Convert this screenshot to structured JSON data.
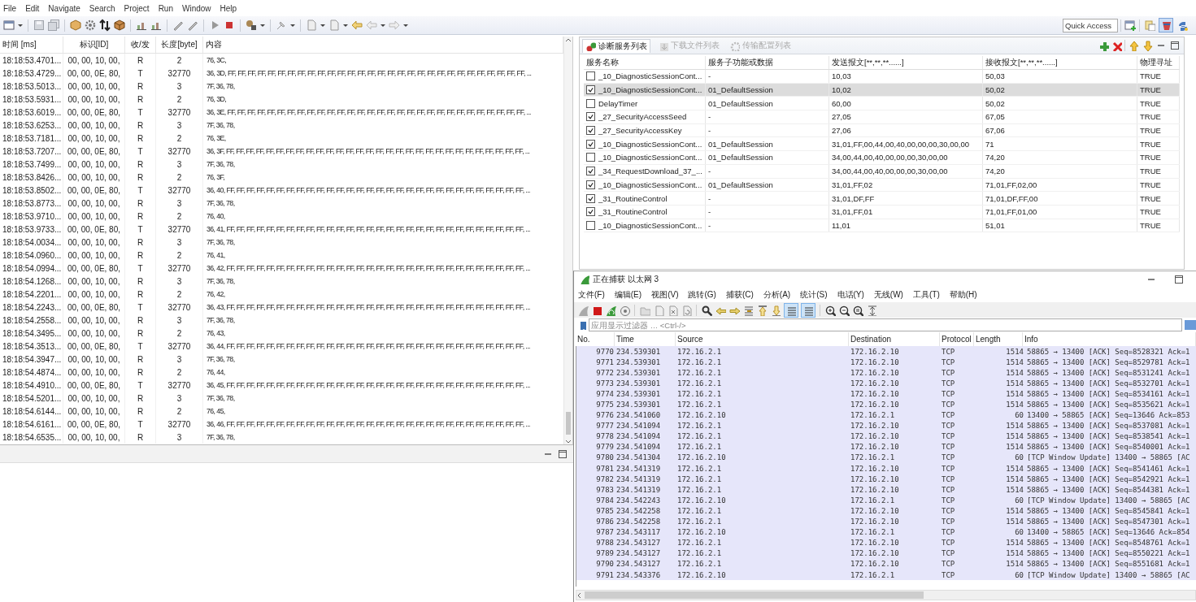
{
  "menu": [
    "File",
    "Edit",
    "Navigate",
    "Search",
    "Project",
    "Run",
    "Window",
    "Help"
  ],
  "quick_access": {
    "placeholder": "Quick Access"
  },
  "perspectives": [
    {
      "selected": false
    },
    {
      "selected": true
    },
    {
      "selected": false
    }
  ],
  "can_table": {
    "columns": [
      "时间 [ms]",
      "标识[ID]",
      "收/发",
      "长度[byte]",
      "内容"
    ],
    "rows": [
      {
        "time": "18:18:53.4701...",
        "id": "00, 00, 10, 00,",
        "dir": "R",
        "length": "2",
        "data": "76, 3C,"
      },
      {
        "time": "18:18:53.4729...",
        "id": "00, 00, 0E, 80,",
        "dir": "T",
        "length": "32770",
        "data": "36, 3D, FF, FF, FF, FF, FF, FF, FF, FF, FF, FF, FF, FF, FF, FF, FF, FF, FF, FF, FF, FF, FF, FF, FF, FF, FF, FF, FF, FF, FF, FF, ..."
      },
      {
        "time": "18:18:53.5013...",
        "id": "00, 00, 10, 00,",
        "dir": "R",
        "length": "3",
        "data": "7F, 36, 78,"
      },
      {
        "time": "18:18:53.5931...",
        "id": "00, 00, 10, 00,",
        "dir": "R",
        "length": "2",
        "data": "76, 3D,"
      },
      {
        "time": "18:18:53.6019...",
        "id": "00, 00, 0E, 80,",
        "dir": "T",
        "length": "32770",
        "data": "36, 3E, FF, FF, FF, FF, FF, FF, FF, FF, FF, FF, FF, FF, FF, FF, FF, FF, FF, FF, FF, FF, FF, FF, FF, FF, FF, FF, FF, FF, FF, FF, ..."
      },
      {
        "time": "18:18:53.6253...",
        "id": "00, 00, 10, 00,",
        "dir": "R",
        "length": "3",
        "data": "7F, 36, 78,"
      },
      {
        "time": "18:18:53.7181...",
        "id": "00, 00, 10, 00,",
        "dir": "R",
        "length": "2",
        "data": "76, 3E,"
      },
      {
        "time": "18:18:53.7207...",
        "id": "00, 00, 0E, 80,",
        "dir": "T",
        "length": "32770",
        "data": "36, 3F, FF, FF, FF, FF, FF, FF, FF, FF, FF, FF, FF, FF, FF, FF, FF, FF, FF, FF, FF, FF, FF, FF, FF, FF, FF, FF, FF, FF, FF, FF, ..."
      },
      {
        "time": "18:18:53.7499...",
        "id": "00, 00, 10, 00,",
        "dir": "R",
        "length": "3",
        "data": "7F, 36, 78,"
      },
      {
        "time": "18:18:53.8426...",
        "id": "00, 00, 10, 00,",
        "dir": "R",
        "length": "2",
        "data": "76, 3F,"
      },
      {
        "time": "18:18:53.8502...",
        "id": "00, 00, 0E, 80,",
        "dir": "T",
        "length": "32770",
        "data": "36, 40, FF, FF, FF, FF, FF, FF, FF, FF, FF, FF, FF, FF, FF, FF, FF, FF, FF, FF, FF, FF, FF, FF, FF, FF, FF, FF, FF, FF, FF, FF, ..."
      },
      {
        "time": "18:18:53.8773...",
        "id": "00, 00, 10, 00,",
        "dir": "R",
        "length": "3",
        "data": "7F, 36, 78,"
      },
      {
        "time": "18:18:53.9710...",
        "id": "00, 00, 10, 00,",
        "dir": "R",
        "length": "2",
        "data": "76, 40,"
      },
      {
        "time": "18:18:53.9733...",
        "id": "00, 00, 0E, 80,",
        "dir": "T",
        "length": "32770",
        "data": "36, 41, FF, FF, FF, FF, FF, FF, FF, FF, FF, FF, FF, FF, FF, FF, FF, FF, FF, FF, FF, FF, FF, FF, FF, FF, FF, FF, FF, FF, FF, FF, ..."
      },
      {
        "time": "18:18:54.0034...",
        "id": "00, 00, 10, 00,",
        "dir": "R",
        "length": "3",
        "data": "7F, 36, 78,"
      },
      {
        "time": "18:18:54.0960...",
        "id": "00, 00, 10, 00,",
        "dir": "R",
        "length": "2",
        "data": "76, 41,"
      },
      {
        "time": "18:18:54.0994...",
        "id": "00, 00, 0E, 80,",
        "dir": "T",
        "length": "32770",
        "data": "36, 42, FF, FF, FF, FF, FF, FF, FF, FF, FF, FF, FF, FF, FF, FF, FF, FF, FF, FF, FF, FF, FF, FF, FF, FF, FF, FF, FF, FF, FF, FF, ..."
      },
      {
        "time": "18:18:54.1268...",
        "id": "00, 00, 10, 00,",
        "dir": "R",
        "length": "3",
        "data": "7F, 36, 78,"
      },
      {
        "time": "18:18:54.2201...",
        "id": "00, 00, 10, 00,",
        "dir": "R",
        "length": "2",
        "data": "76, 42,"
      },
      {
        "time": "18:18:54.2243...",
        "id": "00, 00, 0E, 80,",
        "dir": "T",
        "length": "32770",
        "data": "36, 43, FF, FF, FF, FF, FF, FF, FF, FF, FF, FF, FF, FF, FF, FF, FF, FF, FF, FF, FF, FF, FF, FF, FF, FF, FF, FF, FF, FF, FF, FF, ..."
      },
      {
        "time": "18:18:54.2558...",
        "id": "00, 00, 10, 00,",
        "dir": "R",
        "length": "3",
        "data": "7F, 36, 78,"
      },
      {
        "time": "18:18:54.3495...",
        "id": "00, 00, 10, 00,",
        "dir": "R",
        "length": "2",
        "data": "76, 43,"
      },
      {
        "time": "18:18:54.3513...",
        "id": "00, 00, 0E, 80,",
        "dir": "T",
        "length": "32770",
        "data": "36, 44, FF, FF, FF, FF, FF, FF, FF, FF, FF, FF, FF, FF, FF, FF, FF, FF, FF, FF, FF, FF, FF, FF, FF, FF, FF, FF, FF, FF, FF, FF, ..."
      },
      {
        "time": "18:18:54.3947...",
        "id": "00, 00, 10, 00,",
        "dir": "R",
        "length": "3",
        "data": "7F, 36, 78,"
      },
      {
        "time": "18:18:54.4874...",
        "id": "00, 00, 10, 00,",
        "dir": "R",
        "length": "2",
        "data": "76, 44,"
      },
      {
        "time": "18:18:54.4910...",
        "id": "00, 00, 0E, 80,",
        "dir": "T",
        "length": "32770",
        "data": "36, 45, FF, FF, FF, FF, FF, FF, FF, FF, FF, FF, FF, FF, FF, FF, FF, FF, FF, FF, FF, FF, FF, FF, FF, FF, FF, FF, FF, FF, FF, FF, ..."
      },
      {
        "time": "18:18:54.5201...",
        "id": "00, 00, 10, 00,",
        "dir": "R",
        "length": "3",
        "data": "7F, 36, 78,"
      },
      {
        "time": "18:18:54.6144...",
        "id": "00, 00, 10, 00,",
        "dir": "R",
        "length": "2",
        "data": "76, 45,"
      },
      {
        "time": "18:18:54.6161...",
        "id": "00, 00, 0E, 80,",
        "dir": "T",
        "length": "32770",
        "data": "36, 46, FF, FF, FF, FF, FF, FF, FF, FF, FF, FF, FF, FF, FF, FF, FF, FF, FF, FF, FF, FF, FF, FF, FF, FF, FF, FF, FF, FF, FF, FF, ..."
      },
      {
        "time": "18:18:54.6535...",
        "id": "00, 00, 10, 00,",
        "dir": "R",
        "length": "3",
        "data": "7F, 36, 78,"
      }
    ]
  },
  "diag_panel": {
    "tabs": [
      {
        "label": "诊断服务列表",
        "selected": true,
        "disabled": false
      },
      {
        "label": "下载文件列表",
        "selected": false,
        "disabled": true
      },
      {
        "label": "传输配置列表",
        "selected": false,
        "disabled": true
      }
    ]
  },
  "diag_table": {
    "columns": [
      "服务名称",
      "服务子功能或数据",
      "发送报文[**,**,**......]",
      "接收报文[**,**,**......]",
      "物理寻址"
    ],
    "rows": [
      {
        "checked": false,
        "selected": false,
        "name": "_10_DiagnosticSessionCont...",
        "sub_function": "-",
        "send": "10,03",
        "receive": "50,03",
        "physical": "TRUE"
      },
      {
        "checked": true,
        "selected": true,
        "name": "_10_DiagnosticSessionCont...",
        "sub_function": "01_DefaultSession",
        "send": "10,02",
        "receive": "50,02",
        "physical": "TRUE"
      },
      {
        "checked": false,
        "selected": false,
        "name": "DelayTimer",
        "sub_function": "01_DefaultSession",
        "send": "60,00",
        "receive": "50,02",
        "physical": "TRUE"
      },
      {
        "checked": true,
        "selected": false,
        "name": "_27_SecurityAccessSeed",
        "sub_function": "-",
        "send": "27,05",
        "receive": "67,05",
        "physical": "TRUE"
      },
      {
        "checked": true,
        "selected": false,
        "name": "_27_SecurityAccessKey",
        "sub_function": "-",
        "send": "27,06",
        "receive": "67,06",
        "physical": "TRUE"
      },
      {
        "checked": true,
        "selected": false,
        "name": "_10_DiagnosticSessionCont...",
        "sub_function": "01_DefaultSession",
        "send": "31,01,FF,00,44,00,40,00,00,00,30,00,00",
        "receive": "71",
        "physical": "TRUE"
      },
      {
        "checked": false,
        "selected": false,
        "name": "_10_DiagnosticSessionCont...",
        "sub_function": "01_DefaultSession",
        "send": "34,00,44,00,40,00,00,00,30,00,00",
        "receive": "74,20",
        "physical": "TRUE"
      },
      {
        "checked": true,
        "selected": false,
        "name": "_34_RequestDownload_37_...",
        "sub_function": "-",
        "send": "34,00,44,00,40,00,00,00,30,00,00",
        "receive": "74,20",
        "physical": "TRUE"
      },
      {
        "checked": true,
        "selected": false,
        "name": "_10_DiagnosticSessionCont...",
        "sub_function": "01_DefaultSession",
        "send": "31,01,FF,02",
        "receive": "71,01,FF,02,00",
        "physical": "TRUE"
      },
      {
        "checked": true,
        "selected": false,
        "name": "_31_RoutineControl",
        "sub_function": "-",
        "send": "31,01,DF,FF",
        "receive": "71,01,DF,FF,00",
        "physical": "TRUE"
      },
      {
        "checked": true,
        "selected": false,
        "name": "_31_RoutineControl",
        "sub_function": "-",
        "send": "31,01,FF,01",
        "receive": "71,01,FF,01,00",
        "physical": "TRUE"
      },
      {
        "checked": false,
        "selected": false,
        "name": "_10_DiagnosticSessionCont...",
        "sub_function": "-",
        "send": "11,01",
        "receive": "51,01",
        "physical": "TRUE"
      }
    ]
  },
  "wireshark": {
    "title": "正在捕获 以太网 3",
    "menu": [
      "文件(F)",
      "编辑(E)",
      "视图(V)",
      "跳转(G)",
      "捕获(C)",
      "分析(A)",
      "统计(S)",
      "电话(Y)",
      "无线(W)",
      "工具(T)",
      "帮助(H)"
    ],
    "view_toggles": [
      {
        "on": true
      },
      {
        "on": true
      }
    ],
    "filter": {
      "placeholder": "应用显示过滤器 … <Ctrl-/>"
    },
    "columns": [
      "No.",
      "Time",
      "Source",
      "Destination",
      "Protocol",
      "Length",
      "Info"
    ],
    "rows": [
      {
        "no": "9770",
        "time": "234.539301",
        "source": "172.16.2.1",
        "destination": "172.16.2.10",
        "protocol": "TCP",
        "length": "1514",
        "info": "58865 → 13400 [ACK] Seq=8528321 Ack=1"
      },
      {
        "no": "9771",
        "time": "234.539301",
        "source": "172.16.2.1",
        "destination": "172.16.2.10",
        "protocol": "TCP",
        "length": "1514",
        "info": "58865 → 13400 [ACK] Seq=8529781 Ack=1"
      },
      {
        "no": "9772",
        "time": "234.539301",
        "source": "172.16.2.1",
        "destination": "172.16.2.10",
        "protocol": "TCP",
        "length": "1514",
        "info": "58865 → 13400 [ACK] Seq=8531241 Ack=1"
      },
      {
        "no": "9773",
        "time": "234.539301",
        "source": "172.16.2.1",
        "destination": "172.16.2.10",
        "protocol": "TCP",
        "length": "1514",
        "info": "58865 → 13400 [ACK] Seq=8532701 Ack=1"
      },
      {
        "no": "9774",
        "time": "234.539301",
        "source": "172.16.2.1",
        "destination": "172.16.2.10",
        "protocol": "TCP",
        "length": "1514",
        "info": "58865 → 13400 [ACK] Seq=8534161 Ack=1"
      },
      {
        "no": "9775",
        "time": "234.539301",
        "source": "172.16.2.1",
        "destination": "172.16.2.10",
        "protocol": "TCP",
        "length": "1514",
        "info": "58865 → 13400 [ACK] Seq=8535621 Ack=1"
      },
      {
        "no": "9776",
        "time": "234.541060",
        "source": "172.16.2.10",
        "destination": "172.16.2.1",
        "protocol": "TCP",
        "length": "60",
        "info": "13400 → 58865 [ACK] Seq=13646 Ack=853"
      },
      {
        "no": "9777",
        "time": "234.541094",
        "source": "172.16.2.1",
        "destination": "172.16.2.10",
        "protocol": "TCP",
        "length": "1514",
        "info": "58865 → 13400 [ACK] Seq=8537081 Ack=1"
      },
      {
        "no": "9778",
        "time": "234.541094",
        "source": "172.16.2.1",
        "destination": "172.16.2.10",
        "protocol": "TCP",
        "length": "1514",
        "info": "58865 → 13400 [ACK] Seq=8538541 Ack=1"
      },
      {
        "no": "9779",
        "time": "234.541094",
        "source": "172.16.2.1",
        "destination": "172.16.2.10",
        "protocol": "TCP",
        "length": "1514",
        "info": "58865 → 13400 [ACK] Seq=8540001 Ack=1"
      },
      {
        "no": "9780",
        "time": "234.541304",
        "source": "172.16.2.10",
        "destination": "172.16.2.1",
        "protocol": "TCP",
        "length": "60",
        "info": "[TCP Window Update] 13400 → 58865 [AC"
      },
      {
        "no": "9781",
        "time": "234.541319",
        "source": "172.16.2.1",
        "destination": "172.16.2.10",
        "protocol": "TCP",
        "length": "1514",
        "info": "58865 → 13400 [ACK] Seq=8541461 Ack=1"
      },
      {
        "no": "9782",
        "time": "234.541319",
        "source": "172.16.2.1",
        "destination": "172.16.2.10",
        "protocol": "TCP",
        "length": "1514",
        "info": "58865 → 13400 [ACK] Seq=8542921 Ack=1"
      },
      {
        "no": "9783",
        "time": "234.541319",
        "source": "172.16.2.1",
        "destination": "172.16.2.10",
        "protocol": "TCP",
        "length": "1514",
        "info": "58865 → 13400 [ACK] Seq=8544381 Ack=1"
      },
      {
        "no": "9784",
        "time": "234.542243",
        "source": "172.16.2.10",
        "destination": "172.16.2.1",
        "protocol": "TCP",
        "length": "60",
        "info": "[TCP Window Update] 13400 → 58865 [AC"
      },
      {
        "no": "9785",
        "time": "234.542258",
        "source": "172.16.2.1",
        "destination": "172.16.2.10",
        "protocol": "TCP",
        "length": "1514",
        "info": "58865 → 13400 [ACK] Seq=8545841 Ack=1"
      },
      {
        "no": "9786",
        "time": "234.542258",
        "source": "172.16.2.1",
        "destination": "172.16.2.10",
        "protocol": "TCP",
        "length": "1514",
        "info": "58865 → 13400 [ACK] Seq=8547301 Ack=1"
      },
      {
        "no": "9787",
        "time": "234.543117",
        "source": "172.16.2.10",
        "destination": "172.16.2.1",
        "protocol": "TCP",
        "length": "60",
        "info": "13400 → 58865 [ACK] Seq=13646 Ack=854"
      },
      {
        "no": "9788",
        "time": "234.543127",
        "source": "172.16.2.1",
        "destination": "172.16.2.10",
        "protocol": "TCP",
        "length": "1514",
        "info": "58865 → 13400 [ACK] Seq=8548761 Ack=1"
      },
      {
        "no": "9789",
        "time": "234.543127",
        "source": "172.16.2.1",
        "destination": "172.16.2.10",
        "protocol": "TCP",
        "length": "1514",
        "info": "58865 → 13400 [ACK] Seq=8550221 Ack=1"
      },
      {
        "no": "9790",
        "time": "234.543127",
        "source": "172.16.2.1",
        "destination": "172.16.2.10",
        "protocol": "TCP",
        "length": "1514",
        "info": "58865 → 13400 [ACK] Seq=8551681 Ack=1"
      },
      {
        "no": "9791",
        "time": "234.543376",
        "source": "172.16.2.10",
        "destination": "172.16.2.1",
        "protocol": "TCP",
        "length": "60",
        "info": "[TCP Window Update] 13400 → 58865 [AC"
      }
    ]
  }
}
